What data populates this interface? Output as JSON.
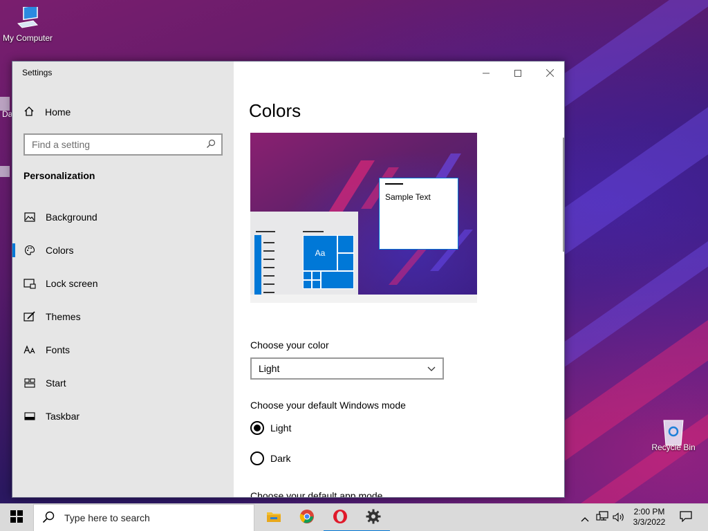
{
  "desktop": {
    "icons": [
      {
        "label": "My Computer",
        "icon": "computer-icon"
      },
      {
        "label": "Recycle Bin",
        "icon": "recycle-bin-icon"
      }
    ],
    "partial_labels": [
      "Da",
      "C"
    ]
  },
  "window": {
    "title": "Settings",
    "controls": [
      "minimize",
      "maximize",
      "close"
    ]
  },
  "sidebar": {
    "home_label": "Home",
    "search_placeholder": "Find a setting",
    "section_title": "Personalization",
    "items": [
      {
        "label": "Background",
        "icon": "picture-icon",
        "active": false
      },
      {
        "label": "Colors",
        "icon": "palette-icon",
        "active": true
      },
      {
        "label": "Lock screen",
        "icon": "lock-screen-icon",
        "active": false
      },
      {
        "label": "Themes",
        "icon": "themes-icon",
        "active": false
      },
      {
        "label": "Fonts",
        "icon": "fonts-icon",
        "active": false
      },
      {
        "label": "Start",
        "icon": "start-icon",
        "active": false
      },
      {
        "label": "Taskbar",
        "icon": "taskbar-icon",
        "active": false
      }
    ]
  },
  "main": {
    "title": "Colors",
    "preview": {
      "sample_text": "Sample Text",
      "tile_text": "Aa"
    },
    "choose_color": {
      "label": "Choose your color",
      "value": "Light"
    },
    "windows_mode": {
      "label": "Choose your default Windows mode",
      "options": [
        {
          "label": "Light",
          "selected": true
        },
        {
          "label": "Dark",
          "selected": false
        }
      ]
    },
    "app_mode": {
      "label": "Choose your default app mode"
    }
  },
  "taskbar": {
    "search_placeholder": "Type here to search",
    "apps": [
      "file-explorer-icon",
      "chrome-icon",
      "opera-icon",
      "settings-icon"
    ],
    "active_app": "settings-icon",
    "time": "2:00 PM",
    "date": "3/3/2022"
  },
  "colors": {
    "accent": "#0078d7",
    "sidebar_bg": "#e6e6e6",
    "taskbar_bg": "#dadada"
  }
}
